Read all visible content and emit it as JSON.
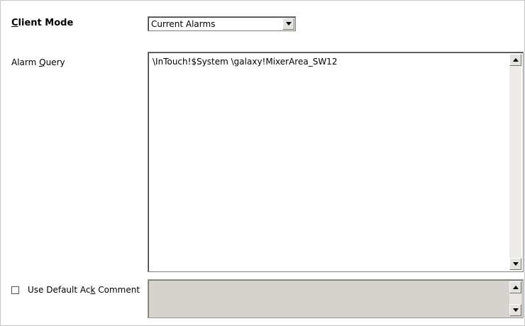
{
  "client_mode": {
    "label_prefix": "C",
    "label_rest": "lient Mode",
    "selected": "Current Alarms"
  },
  "alarm_query": {
    "label_prefix": "Alarm ",
    "label_underlined": "Q",
    "label_rest": "uery",
    "value": "\\InTouch!$System \\galaxy!MixerArea_SW12"
  },
  "ack_comment": {
    "label_prefix": "Use Default Ac",
    "label_underlined": "k",
    "label_rest": " Comment",
    "checked": false,
    "value": ""
  }
}
